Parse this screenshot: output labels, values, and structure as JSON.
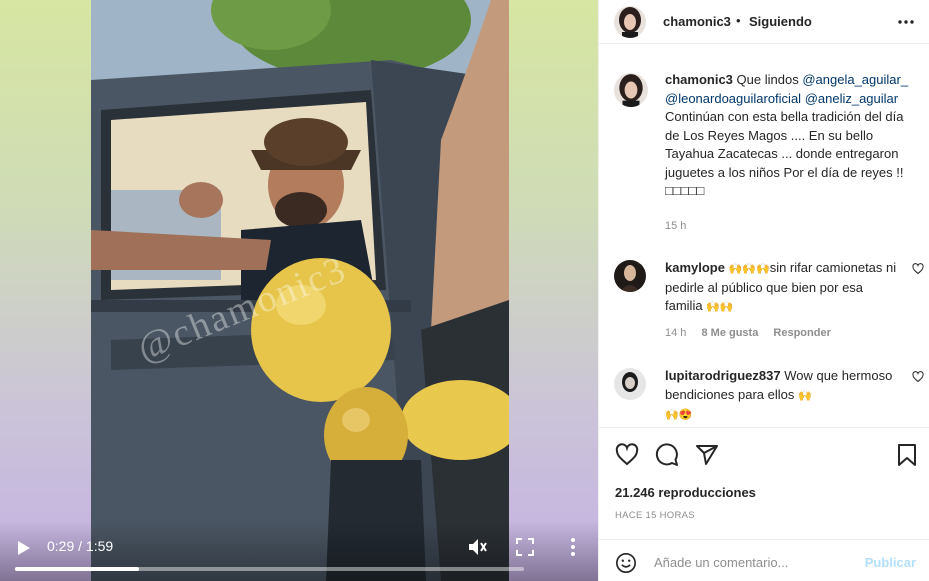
{
  "video": {
    "time": "0:29 / 1:59",
    "progress": 0.244,
    "watermark": "@chamonic3",
    "icons": {
      "play": "play-icon",
      "mute": "mute-icon",
      "fullscreen": "fullscreen-icon",
      "more": "more-vertical-icon"
    }
  },
  "header": {
    "username": "chamonic3",
    "dot": "•",
    "follow": "Siguiendo",
    "more_icon": "more-horizontal-icon"
  },
  "caption": {
    "username": "chamonic3",
    "intro": "Que lindos",
    "mentions": [
      "@angela_aguilar_",
      "@leonardoaguilaroficial",
      "@aneliz_aguilar"
    ],
    "body": "Continúan con esta bella tradición del día de Los Reyes Magos .... En su bello Tayahua Zacatecas ... donde entregaron juguetes a los niños Por el día de reyes !!",
    "emojis": "□□□□□",
    "time": "15 h"
  },
  "comments": [
    {
      "username": "kamylope",
      "text_a": "sin rifar camionetas ni pedirle al público que bien por esa familia",
      "time": "14 h",
      "likes": "8 Me gusta",
      "reply": "Responder"
    },
    {
      "username": "lupitarodriguez837",
      "text_a": "Wow que hermoso bendiciones para ellos"
    }
  ],
  "actions": {
    "views": "21.246 reproducciones",
    "ago": "HACE 15 HORAS",
    "icons": [
      "heart-icon",
      "comment-icon",
      "share-icon",
      "bookmark-icon"
    ]
  },
  "add_comment": {
    "placeholder": "Añade un comentario...",
    "publish": "Publicar"
  },
  "colors": {
    "link": "#00376b",
    "muted": "#8e8e8e",
    "publish_disabled": "#b2dffc"
  }
}
